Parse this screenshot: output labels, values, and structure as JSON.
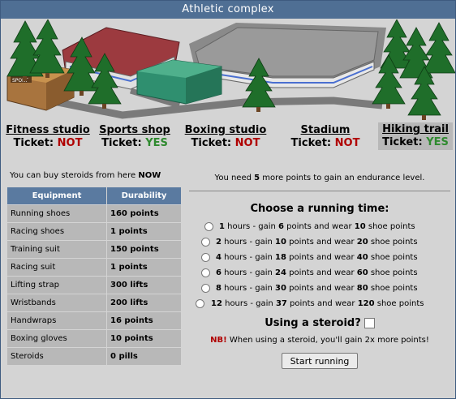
{
  "window": {
    "title": "Athletic complex"
  },
  "locations": [
    {
      "name": "Fitness studio",
      "ticket_label": "Ticket:",
      "ticket_value": "NOT",
      "status": "no"
    },
    {
      "name": "Sports shop",
      "ticket_label": "Ticket:",
      "ticket_value": "YES",
      "status": "yes"
    },
    {
      "name": "Boxing studio",
      "ticket_label": "Ticket:",
      "ticket_value": "NOT",
      "status": "no"
    },
    {
      "name": "Stadium",
      "ticket_label": "Ticket:",
      "ticket_value": "NOT",
      "status": "no"
    },
    {
      "name": "Hiking trail",
      "ticket_label": "Ticket:",
      "ticket_value": "YES",
      "status": "yes",
      "active": true
    }
  ],
  "scene": {
    "sign_text": "SPORT"
  },
  "steroid_notice": {
    "text": "You can buy steroids from here",
    "highlight": "NOW"
  },
  "equipment": {
    "headers": [
      "Equipment",
      "Durability"
    ],
    "rows": [
      {
        "item": "Running shoes",
        "durability": "160 points"
      },
      {
        "item": "Racing shoes",
        "durability": "1 points"
      },
      {
        "item": "Training suit",
        "durability": "150 points"
      },
      {
        "item": "Racing suit",
        "durability": "1 points"
      },
      {
        "item": "Lifting strap",
        "durability": "300 lifts"
      },
      {
        "item": "Wristbands",
        "durability": "200 lifts"
      },
      {
        "item": "Handwraps",
        "durability": "16 points"
      },
      {
        "item": "Boxing gloves",
        "durability": "10 points"
      },
      {
        "item": "Steroids",
        "durability": "0 pills"
      }
    ]
  },
  "endurance": {
    "prefix": "You need",
    "points": "5",
    "suffix": "more points to gain an endurance level."
  },
  "running": {
    "title": "Choose a running time:",
    "options": [
      {
        "hours": "1",
        "points": "6",
        "shoe": "10"
      },
      {
        "hours": "2",
        "points": "10",
        "shoe": "20"
      },
      {
        "hours": "4",
        "points": "18",
        "shoe": "40"
      },
      {
        "hours": "6",
        "points": "24",
        "shoe": "60"
      },
      {
        "hours": "8",
        "points": "30",
        "shoe": "80"
      },
      {
        "hours": "12",
        "points": "37",
        "shoe": "120"
      }
    ],
    "steroid_question": "Using a steroid?",
    "nb_label": "NB!",
    "nb_text": "When using a steroid, you'll gain 2x more points!",
    "button": "Start running"
  },
  "colors": {
    "titlebar": "#4f6f94",
    "table_header": "#5a7aa0",
    "no": "#b00000",
    "yes": "#2f8a2f"
  }
}
